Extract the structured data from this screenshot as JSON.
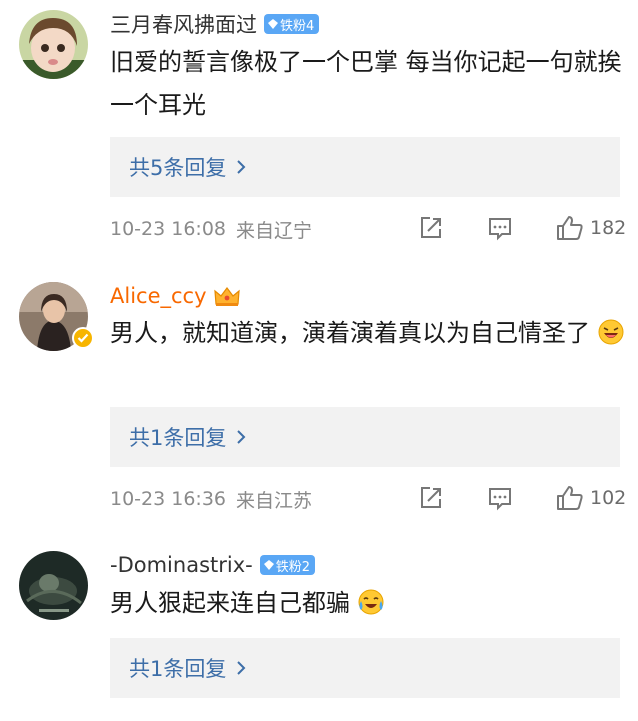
{
  "comments": [
    {
      "username": "三月春风拂面过",
      "badge": "铁粉4",
      "text": "旧爱的誓言像极了一个巴掌 每当你记起一句就挨一个耳光",
      "replies": "共5条回复",
      "time": "10-23 16:08",
      "location": "来自辽宁",
      "likes": "182"
    },
    {
      "username": "Alice_ccy",
      "text": "男人，就知道演，演着演着真以为自己情圣了",
      "replies": "共1条回复",
      "time": "10-23 16:36",
      "location": "来自江苏",
      "likes": "102"
    },
    {
      "username": "-Dominastrix-",
      "badge": "铁粉2",
      "text": "男人狠起来连自己都骗",
      "replies": "共1条回复"
    }
  ],
  "colors": {
    "vip_name": "#f86800",
    "reply_link": "#3d6ea8",
    "fan_badge": "#5aa7f5",
    "reply_bg": "#f2f2f2"
  }
}
